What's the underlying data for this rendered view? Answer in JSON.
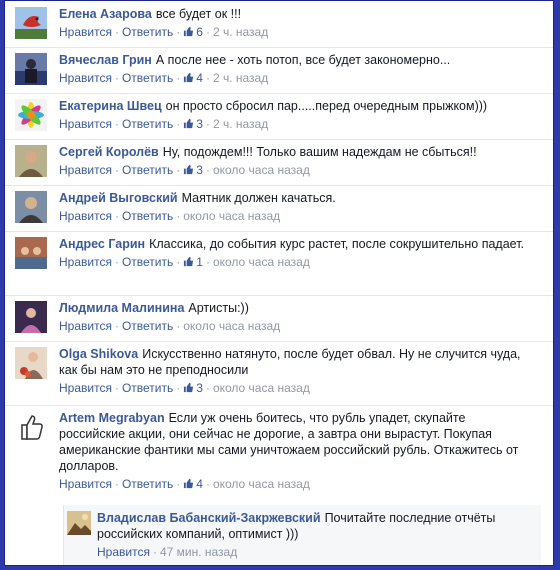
{
  "ui": {
    "like_label": "Нравится",
    "reply_label": "Ответить",
    "separator": "·"
  },
  "comments": [
    {
      "author": "Елена Азарова",
      "text": "все будет ок !!!",
      "likes": "6",
      "time": "2 ч. назад",
      "avatar_icon": "avatar-bird-icon",
      "avatar_colors": [
        "#9fc3e8",
        "#c8302a"
      ]
    },
    {
      "author": "Вячеслав Грин",
      "text": "А после нее - хоть потоп, все будет закономерно...",
      "likes": "4",
      "time": "2 ч. назад",
      "avatar_icon": "avatar-figure-icon",
      "avatar_colors": [
        "#6a7aa8",
        "#2b3b6e"
      ]
    },
    {
      "author": "Екатерина Швец",
      "text": "он просто сбросил пар.....перед очередным прыжком)))",
      "likes": "3",
      "time": "2 ч. назад",
      "avatar_icon": "avatar-flower-icon",
      "avatar_colors": [
        "#f4d020",
        "#d23c8c"
      ]
    },
    {
      "author": "Сергей Королёв",
      "text": "Ну, подождем!!! Только вашим надеждам не сбыться!!",
      "likes": "3",
      "time": "около часа назад",
      "avatar_icon": "avatar-man-icon",
      "avatar_colors": [
        "#b9b08e",
        "#6f5b3e"
      ]
    },
    {
      "author": "Андрей Выговский",
      "text": "Маятник должен качаться.",
      "likes": "",
      "time": "около часа назад",
      "avatar_icon": "avatar-man-icon",
      "avatar_colors": [
        "#7b8ea6",
        "#d1b48c"
      ]
    },
    {
      "author": "Андрес Гарин",
      "text": "Классика, до события курс растет, после сокрушительно падает.",
      "likes": "1",
      "time": "около часа назад",
      "avatar_icon": "avatar-group-icon",
      "avatar_colors": [
        "#a86a4e",
        "#4e6a8c"
      ]
    },
    {
      "author": "Людмила Малинина",
      "text": "Артисты:))",
      "likes": "",
      "time": "около часа назад",
      "avatar_icon": "avatar-portrait-icon",
      "avatar_colors": [
        "#3a2a4e",
        "#c46ea8"
      ]
    },
    {
      "author": "Olga Shikova",
      "text": "Искусственно натянуто, после будет обвал. Ну не случится чуда, как бы нам это не преподносили",
      "likes": "3",
      "time": "около часа назад",
      "avatar_icon": "avatar-woman-flowers-icon",
      "avatar_colors": [
        "#e8d8c8",
        "#c83a2a"
      ]
    },
    {
      "author": "Artem Megrabyan",
      "text": "Если уж очень боитесь, что рубль упадет, скупайте российские акции, они сейчас не дорогие, а завтра они вырастут. Покупая американские фантики мы сами уничтожаем российский рубль. Откажитесь от долларов.",
      "likes": "4",
      "time": "около часа назад",
      "avatar_icon": "thumbs-up-avatar-icon",
      "avatar_colors": [
        "#ffffff",
        "#333333"
      ]
    }
  ],
  "reply": {
    "author": "Владислав Бабанский-Закржевский",
    "text": "Почитайте последние отчёты российских компаний, оптимист )))",
    "time": "47 мин. назад",
    "avatar_icon": "avatar-landscape-icon",
    "avatar_colors": [
      "#d8c090",
      "#6a4a2a"
    ]
  },
  "colors": {
    "link": "#3b5998",
    "text": "#141823",
    "muted": "#9197a3",
    "frame": "#2d3aa8"
  }
}
